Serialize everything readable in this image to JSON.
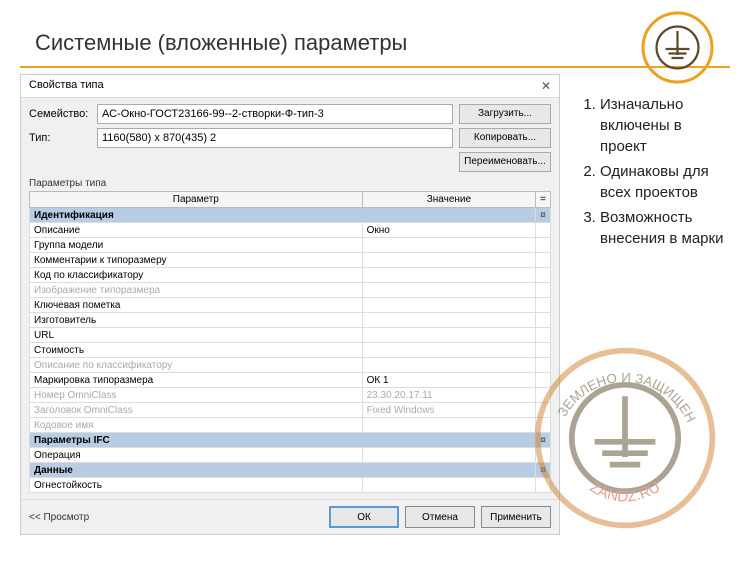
{
  "title": "Системные (вложенные) параметры",
  "logo": {
    "top_text": "ЗАЗЕМЛЕНО И ЗАЩИЩЕНО",
    "bottom_text": "ZANDZ.RU"
  },
  "dialog": {
    "title": "Свойства типа",
    "close": "✕",
    "family_label": "Семейство:",
    "family_value": "АС-Окно-ГОСТ23166-99--2-створки-Ф-тип-3",
    "type_label": "Тип:",
    "type_value": "1160(580) x 870(435) 2",
    "btn_load": "Загрузить...",
    "btn_copy": "Копировать...",
    "btn_rename": "Переименовать...",
    "params_section": "Параметры типа",
    "col_param": "Параметр",
    "col_value": "Значение",
    "col_equals": "=",
    "groups": [
      {
        "label": "Идентификация",
        "rows": [
          {
            "p": "Описание",
            "v": "Окно",
            "disabled": false
          },
          {
            "p": "Группа модели",
            "v": "",
            "disabled": false
          },
          {
            "p": "Комментарии к типоразмеру",
            "v": "",
            "disabled": false
          },
          {
            "p": "Код по классификатору",
            "v": "",
            "disabled": false
          },
          {
            "p": "Изображение типоразмера",
            "v": "",
            "disabled": true
          },
          {
            "p": "Ключевая пометка",
            "v": "",
            "disabled": false
          },
          {
            "p": "Изготовитель",
            "v": "",
            "disabled": false
          },
          {
            "p": "URL",
            "v": "",
            "disabled": false
          },
          {
            "p": "Стоимость",
            "v": "",
            "disabled": false
          },
          {
            "p": "Описание по классификатору",
            "v": "",
            "disabled": true
          },
          {
            "p": "Маркировка типоразмера",
            "v": "ОК 1",
            "disabled": false
          },
          {
            "p": "Номер OmniClass",
            "v": "23.30.20.17.11",
            "disabled": true
          },
          {
            "p": "Заголовок OmniClass",
            "v": "Fixed Windows",
            "disabled": true
          },
          {
            "p": "Кодовое имя",
            "v": "",
            "disabled": true
          }
        ]
      },
      {
        "label": "Параметры IFC",
        "rows": [
          {
            "p": "Операция",
            "v": "",
            "disabled": false
          }
        ]
      },
      {
        "label": "Данные",
        "rows": [
          {
            "p": "Огнестойкость",
            "v": "",
            "disabled": false
          }
        ]
      }
    ],
    "preview": "<<  Просмотр",
    "btn_ok": "ОК",
    "btn_cancel": "Отмена",
    "btn_apply": "Применить"
  },
  "notes": [
    "Изначально включены в проект",
    "Одинаковы для всех проектов",
    "Возможность внесения в марки"
  ]
}
